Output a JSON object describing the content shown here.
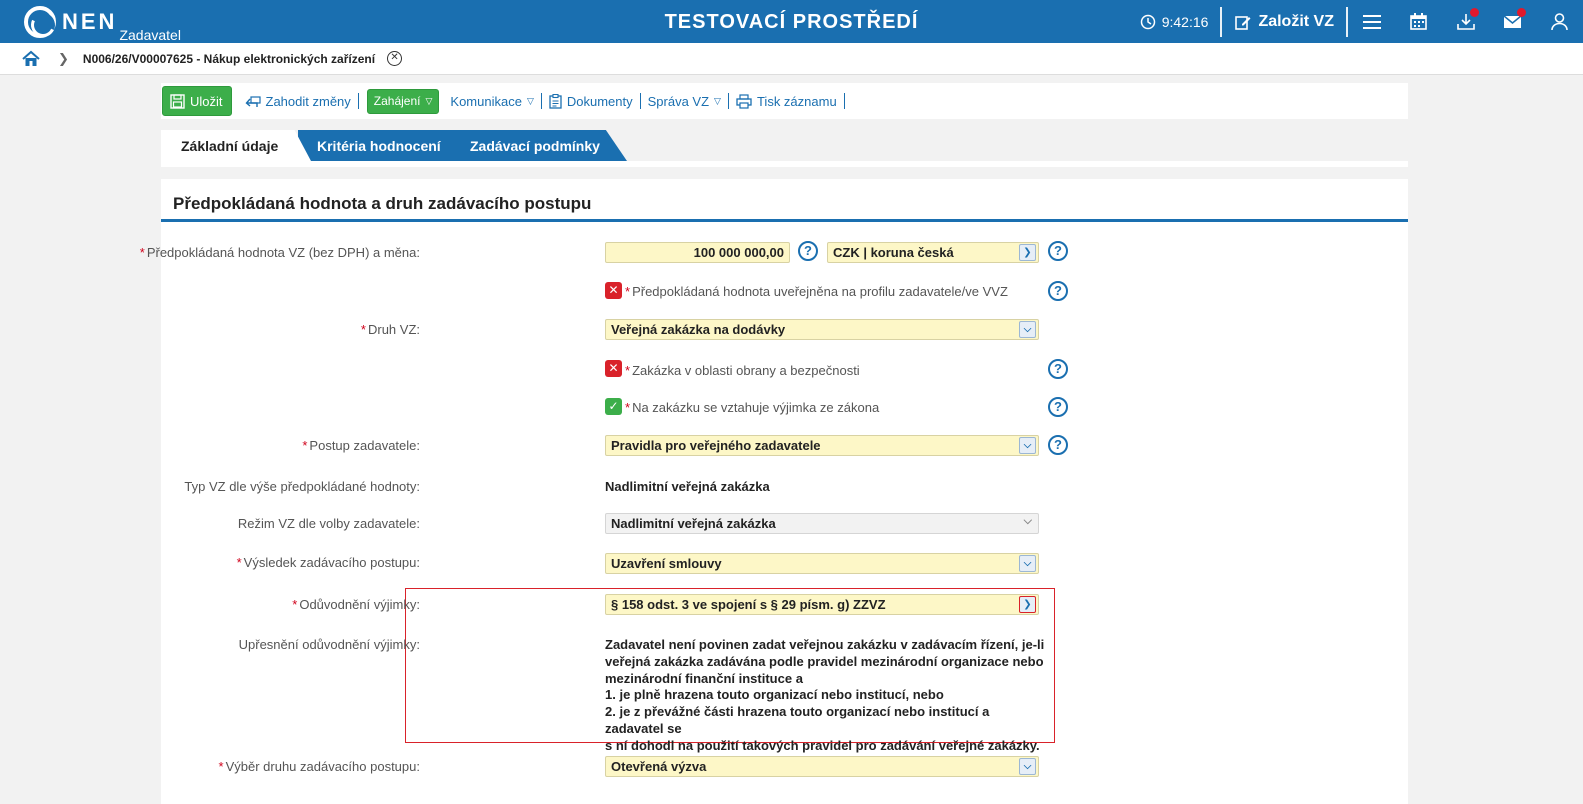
{
  "app": {
    "logo_text": "NEN",
    "logo_sub": "Zadavatel",
    "env_title": "TESTOVACÍ PROSTŘEDÍ",
    "clock": "9:42:16",
    "create_label": "Založit VZ"
  },
  "breadcrumb": {
    "text": "N006/26/V00007625 - Nákup elektronických zařízení"
  },
  "toolbar": {
    "save": "Uložit",
    "discard": "Zahodit změny",
    "start": "Zahájení",
    "comm": "Komunikace",
    "docs": "Dokumenty",
    "manage": "Správa VZ",
    "print": "Tisk záznamu"
  },
  "tabs": [
    "Základní údaje",
    "Kritéria hodnocení",
    "Zadávací podmínky"
  ],
  "section": {
    "title": "Předpokládaná hodnota a druh zadávacího postupu"
  },
  "form": {
    "value_label": "Předpokládaná hodnota VZ (bez DPH) a měna:",
    "value": "100 000 000,00",
    "currency": "CZK | koruna česká",
    "published_label": "Předpokládaná hodnota uveřejněna na profilu zadavatele/ve VVZ",
    "type_label": "Druh VZ:",
    "type_value": "Veřejná zakázka na dodávky",
    "defense_label": "Zakázka v oblasti obrany a bezpečnosti",
    "exception_label": "Na zakázku se vztahuje výjimka ze zákona",
    "procedure_label": "Postup zadavatele:",
    "procedure_value": "Pravidla pro veřejného zadavatele",
    "typ_label": "Typ VZ dle výše předpokládané hodnoty:",
    "typ_value": "Nadlimitní veřejná zakázka",
    "regime_label": "Režim VZ dle volby zadavatele:",
    "regime_value": "Nadlimitní veřejná zakázka",
    "result_label": "Výsledek zadávacího postupu:",
    "result_value": "Uzavření smlouvy",
    "justif_label": "Odůvodnění výjimky:",
    "justif_value": "§ 158 odst. 3 ve spojení s § 29 písm. g) ZZVZ",
    "detail_label": "Upřesnění odůvodnění výjimky:",
    "detail_lines": [
      "Zadavatel není povinen zadat veřejnou zakázku v zadávacím řízení, je-li",
      "veřejná zakázka zadávána podle pravidel mezinárodní organizace nebo",
      "mezinárodní finanční instituce a",
      "1. je plně hrazena touto organizací nebo institucí, nebo",
      "2. je z převážné části hrazena touto organizací nebo institucí a zadavatel se",
      "s ní dohodl na použití takových pravidel pro zadávání veřejné zakázky."
    ],
    "selection_label": "Výběr druhu zadávacího postupu:",
    "selection_value": "Otevřená výzva"
  }
}
